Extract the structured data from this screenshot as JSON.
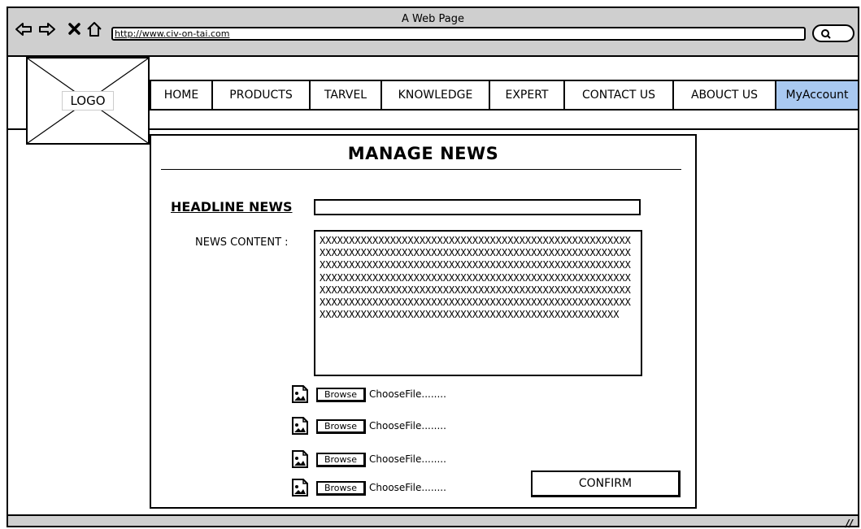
{
  "browser": {
    "title": "A Web Page",
    "url": "http://www.civ-on-tai.com",
    "icons": [
      "back-icon",
      "forward-icon",
      "close-icon",
      "home-icon",
      "search-icon"
    ]
  },
  "header": {
    "logo_label": "LOGO",
    "nav": [
      {
        "label": "HOME",
        "active": false
      },
      {
        "label": "PRODUCTS",
        "active": false
      },
      {
        "label": "TARVEL",
        "active": false
      },
      {
        "label": "KNOWLEDGE",
        "active": false
      },
      {
        "label": "EXPERT",
        "active": false
      },
      {
        "label": "CONTACT US",
        "active": false
      },
      {
        "label": "ABOUCT US",
        "active": false
      },
      {
        "label": "MyAccount",
        "active": true
      }
    ]
  },
  "form": {
    "title": "MANAGE NEWS",
    "headline_label": "HEADLINE NEWS",
    "headline_value": "",
    "content_label": "NEWS CONTENT :",
    "content_value": "XXXXXXXXXXXXXXXXXXXXXXXXXXXXXXXXXXXXXXXXXXXXXXXXXXXXXXXXXXXXXXXXXXXXXXXXXXXXXXXXXXXXXXXXXXXXXXXXXXXXXXXXXXXXXXXXXXXXXXXXXXXXXXXXXXXXXXXXXXXXXXXXXXXXXXXXXXXXXXXXXXXXXXXXXXXXXXXXXXXXXXXXXXXXXXXXXXXXXXXXXXXXXXXXXXXXXXXXXXXXXXXXXXXXXXXXXXXXXXXXXXXXXXXXXXXXXXXXXXXXXXXXXXXXXXXXXXXXXXXXXXXXXXXXXXXXXXXXXXXXXXXXXXXXXXXXXXXXXXXXXXXXXXXXXXXXXXXXXXXXXXXXXXXXXXXXXXXXXXXXXXXXXXXXX",
    "uploads": [
      {
        "button": "Browse",
        "label": "ChooseFile........"
      },
      {
        "button": "Browse",
        "label": "ChooseFile........"
      },
      {
        "button": "Browse",
        "label": "ChooseFile........"
      },
      {
        "button": "Browse",
        "label": "ChooseFile........"
      }
    ],
    "confirm_label": "CONFIRM"
  },
  "colors": {
    "chrome": "#cfcfcf",
    "active_tab": "#a9c9f1",
    "border": "#000000"
  }
}
